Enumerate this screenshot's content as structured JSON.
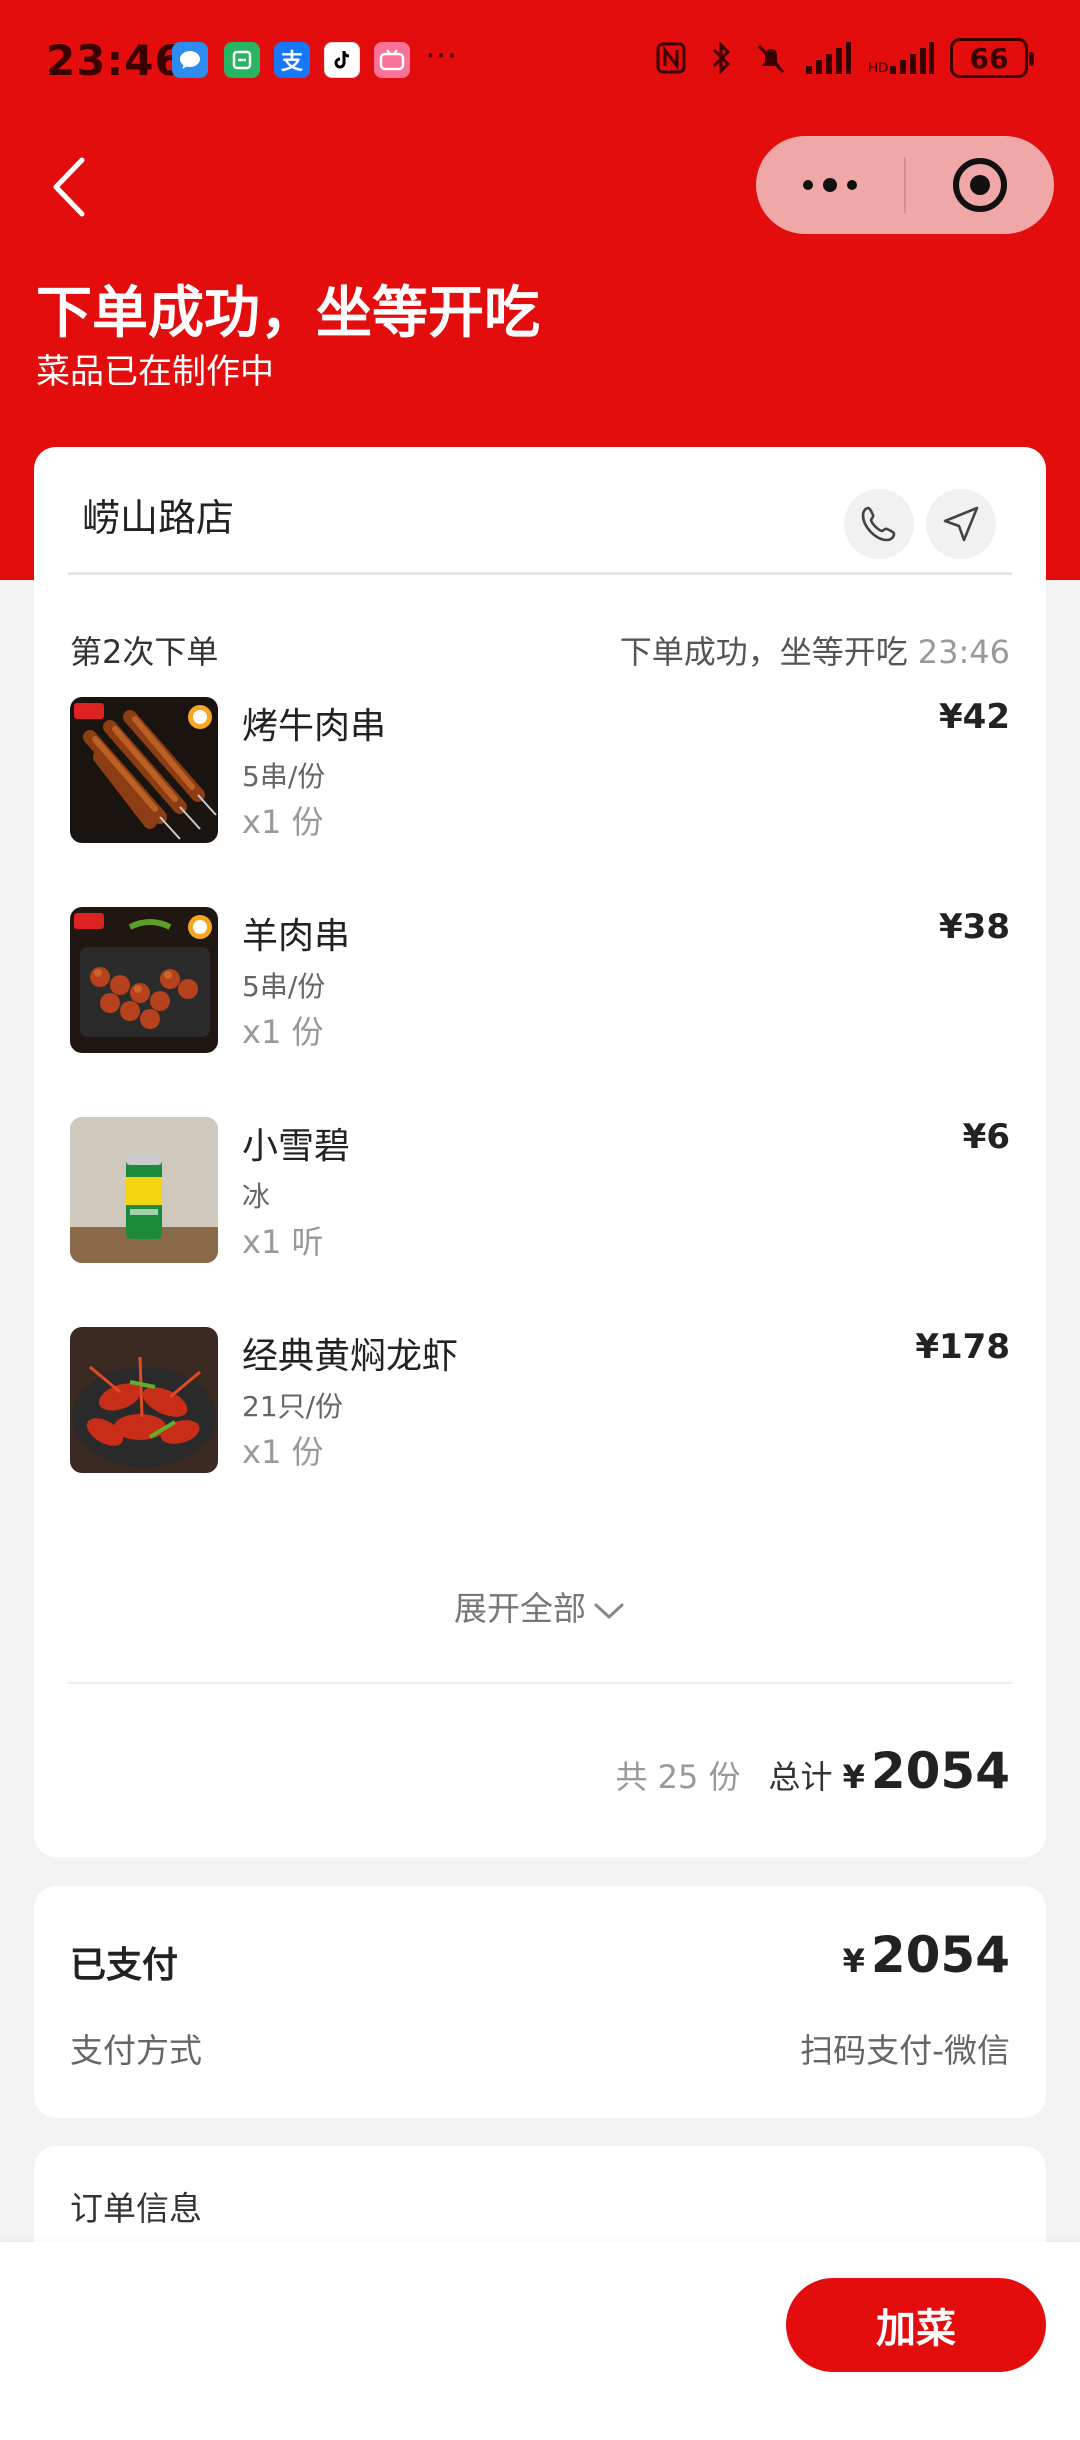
{
  "status_bar": {
    "time": "23:46",
    "more": "···",
    "battery": "66"
  },
  "header": {
    "title": "下单成功，坐等开吃",
    "subtitle": "菜品已在制作中"
  },
  "store": {
    "name": "崂山路店"
  },
  "order": {
    "batch_label": "第2次下单",
    "batch_status": "下单成功，坐等开吃",
    "batch_time": "23:46",
    "items": [
      {
        "name": "烤牛肉串",
        "spec": "5串/份",
        "qty": "x1 份",
        "price": "¥42"
      },
      {
        "name": "羊肉串",
        "spec": "5串/份",
        "qty": "x1 份",
        "price": "¥38"
      },
      {
        "name": "小雪碧",
        "spec": "冰",
        "qty": "x1 听",
        "price": "¥6"
      },
      {
        "name": "经典黄焖龙虾",
        "spec": "21只/份",
        "qty": "x1 份",
        "price": "¥178"
      }
    ],
    "expand_label": "展开全部",
    "count_label": "共 25 份",
    "total_label": "总计",
    "currency": "¥",
    "total": "2054"
  },
  "payment": {
    "status": "已支付",
    "currency": "¥",
    "amount": "2054",
    "method_label": "支付方式",
    "method_value": "扫码支付-微信"
  },
  "info": {
    "title": "订单信息"
  },
  "footer": {
    "add_button": "加菜"
  },
  "colors": {
    "brand_red": "#e30d0d",
    "capsule": "#f0a7a7"
  }
}
